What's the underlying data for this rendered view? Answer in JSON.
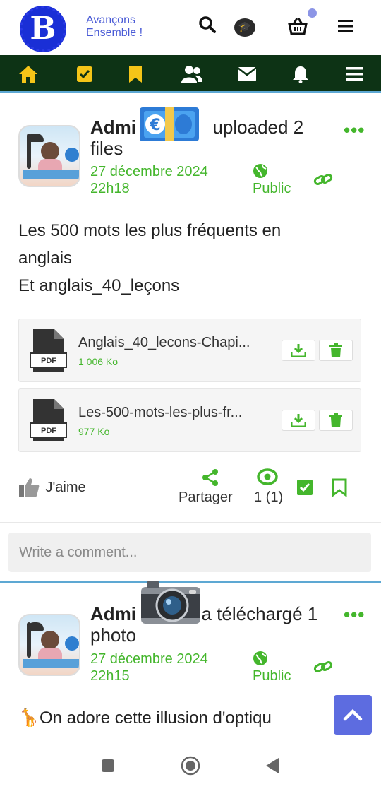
{
  "header": {
    "logo_letter": "B",
    "tagline_line1": "Avançons",
    "tagline_line2": "Ensemble !",
    "icons": [
      "search-icon",
      "graduation-cap-icon",
      "basket-icon",
      "menu-icon"
    ]
  },
  "navbar": {
    "icons": [
      "home-icon",
      "tasks-icon",
      "bookmark-icon",
      "users-icon",
      "envelope-icon",
      "bell-icon",
      "menu-icon"
    ]
  },
  "posts": [
    {
      "author": "Admi",
      "action_line1": "uploaded 2",
      "action_line2": "files",
      "date_line1": "27 décembre 2024",
      "date_line2": "22h18",
      "visibility": "Public",
      "text_lines": [
        "Les 500 mots les plus fréquents en",
        "anglais",
        "Et anglais_40_leçons"
      ],
      "files": [
        {
          "name": "Anglais_40_lecons-Chapi...",
          "size": "1 006 Ko",
          "type": "PDF"
        },
        {
          "name": "Les-500-mots-les-plus-fr...",
          "size": "977 Ko",
          "type": "PDF"
        }
      ],
      "like_label": "J'aime",
      "share_label": "Partager",
      "views": "1 (1)"
    },
    {
      "author": "Admi",
      "action_line1": "a téléchargé 1",
      "action_line2": "photo",
      "date_line1": "27 décembre 2024",
      "date_line2": "22h15",
      "visibility": "Public",
      "text_line": "On adore cette illusion d'optiqu"
    }
  ],
  "comment": {
    "placeholder": "Write a comment..."
  },
  "colors": {
    "accent": "#44b62c",
    "navbar": "#0d3315",
    "nav_icons": "#f5c518",
    "scroll_button": "#5d6ce0"
  }
}
